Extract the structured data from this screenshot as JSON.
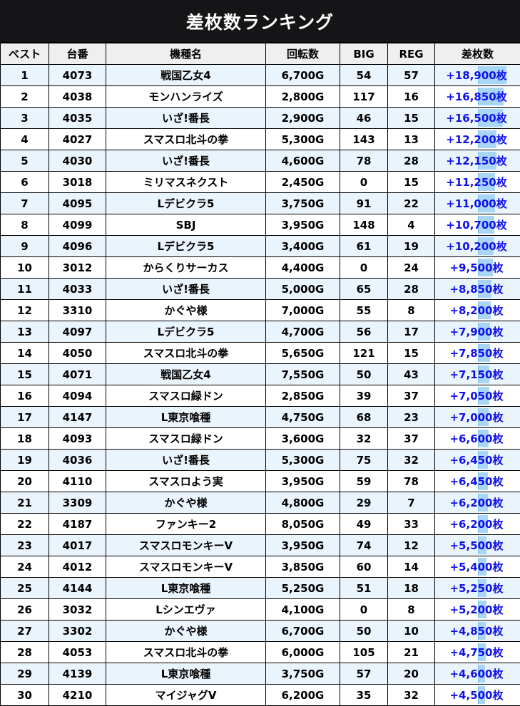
{
  "title": "差枚数ランキング",
  "headers": {
    "rank": "ベスト",
    "machine_no": "台番",
    "model": "機種名",
    "spins": "回転数",
    "big": "BIG",
    "reg": "REG",
    "diff": "差枚数"
  },
  "rows": [
    {
      "rank": "1",
      "no": "4073",
      "model": "戦国乙女4",
      "spins": "6,700G",
      "big": "54",
      "reg": "57",
      "diff": "+18,900枚",
      "diff_value": 18900
    },
    {
      "rank": "2",
      "no": "4038",
      "model": "モンハンライズ",
      "spins": "2,800G",
      "big": "117",
      "reg": "16",
      "diff": "+16,850枚",
      "diff_value": 16850
    },
    {
      "rank": "3",
      "no": "4035",
      "model": "いざ!番長",
      "spins": "2,900G",
      "big": "46",
      "reg": "15",
      "diff": "+16,500枚",
      "diff_value": 16500
    },
    {
      "rank": "4",
      "no": "4027",
      "model": "スマスロ北斗の拳",
      "spins": "5,300G",
      "big": "143",
      "reg": "13",
      "diff": "+12,200枚",
      "diff_value": 12200
    },
    {
      "rank": "5",
      "no": "4030",
      "model": "いざ!番長",
      "spins": "4,600G",
      "big": "78",
      "reg": "28",
      "diff": "+12,150枚",
      "diff_value": 12150
    },
    {
      "rank": "6",
      "no": "3018",
      "model": "ミリマスネクスト",
      "spins": "2,450G",
      "big": "0",
      "reg": "15",
      "diff": "+11,250枚",
      "diff_value": 11250
    },
    {
      "rank": "7",
      "no": "4095",
      "model": "Lデビクラ5",
      "spins": "3,750G",
      "big": "91",
      "reg": "22",
      "diff": "+11,000枚",
      "diff_value": 11000
    },
    {
      "rank": "8",
      "no": "4099",
      "model": "SBJ",
      "spins": "3,950G",
      "big": "148",
      "reg": "4",
      "diff": "+10,700枚",
      "diff_value": 10700
    },
    {
      "rank": "9",
      "no": "4096",
      "model": "Lデビクラ5",
      "spins": "3,400G",
      "big": "61",
      "reg": "19",
      "diff": "+10,200枚",
      "diff_value": 10200
    },
    {
      "rank": "10",
      "no": "3012",
      "model": "からくりサーカス",
      "spins": "4,400G",
      "big": "0",
      "reg": "24",
      "diff": "+9,500枚",
      "diff_value": 9500
    },
    {
      "rank": "11",
      "no": "4033",
      "model": "いざ!番長",
      "spins": "5,000G",
      "big": "65",
      "reg": "28",
      "diff": "+8,850枚",
      "diff_value": 8850
    },
    {
      "rank": "12",
      "no": "3310",
      "model": "かぐや様",
      "spins": "7,000G",
      "big": "55",
      "reg": "8",
      "diff": "+8,200枚",
      "diff_value": 8200
    },
    {
      "rank": "13",
      "no": "4097",
      "model": "Lデビクラ5",
      "spins": "4,700G",
      "big": "56",
      "reg": "17",
      "diff": "+7,900枚",
      "diff_value": 7900
    },
    {
      "rank": "14",
      "no": "4050",
      "model": "スマスロ北斗の拳",
      "spins": "5,650G",
      "big": "121",
      "reg": "15",
      "diff": "+7,850枚",
      "diff_value": 7850
    },
    {
      "rank": "15",
      "no": "4071",
      "model": "戦国乙女4",
      "spins": "7,550G",
      "big": "50",
      "reg": "43",
      "diff": "+7,150枚",
      "diff_value": 7150
    },
    {
      "rank": "16",
      "no": "4094",
      "model": "スマスロ緑ドン",
      "spins": "2,850G",
      "big": "39",
      "reg": "37",
      "diff": "+7,050枚",
      "diff_value": 7050
    },
    {
      "rank": "17",
      "no": "4147",
      "model": "L東京喰種",
      "spins": "4,750G",
      "big": "68",
      "reg": "23",
      "diff": "+7,000枚",
      "diff_value": 7000
    },
    {
      "rank": "18",
      "no": "4093",
      "model": "スマスロ緑ドン",
      "spins": "3,600G",
      "big": "32",
      "reg": "37",
      "diff": "+6,600枚",
      "diff_value": 6600
    },
    {
      "rank": "19",
      "no": "4036",
      "model": "いざ!番長",
      "spins": "5,300G",
      "big": "75",
      "reg": "32",
      "diff": "+6,450枚",
      "diff_value": 6450
    },
    {
      "rank": "20",
      "no": "4110",
      "model": "スマスロよう実",
      "spins": "3,950G",
      "big": "59",
      "reg": "78",
      "diff": "+6,450枚",
      "diff_value": 6450
    },
    {
      "rank": "21",
      "no": "3309",
      "model": "かぐや様",
      "spins": "4,800G",
      "big": "29",
      "reg": "7",
      "diff": "+6,200枚",
      "diff_value": 6200
    },
    {
      "rank": "22",
      "no": "4187",
      "model": "ファンキー2",
      "spins": "8,050G",
      "big": "49",
      "reg": "33",
      "diff": "+6,200枚",
      "diff_value": 6200
    },
    {
      "rank": "23",
      "no": "4017",
      "model": "スマスロモンキーV",
      "spins": "3,950G",
      "big": "74",
      "reg": "12",
      "diff": "+5,500枚",
      "diff_value": 5500
    },
    {
      "rank": "24",
      "no": "4012",
      "model": "スマスロモンキーV",
      "spins": "3,850G",
      "big": "60",
      "reg": "14",
      "diff": "+5,400枚",
      "diff_value": 5400
    },
    {
      "rank": "25",
      "no": "4144",
      "model": "L東京喰種",
      "spins": "5,250G",
      "big": "51",
      "reg": "18",
      "diff": "+5,250枚",
      "diff_value": 5250
    },
    {
      "rank": "26",
      "no": "3032",
      "model": "Lシンエヴァ",
      "spins": "4,100G",
      "big": "0",
      "reg": "8",
      "diff": "+5,200枚",
      "diff_value": 5200
    },
    {
      "rank": "27",
      "no": "3302",
      "model": "かぐや様",
      "spins": "6,700G",
      "big": "50",
      "reg": "10",
      "diff": "+4,850枚",
      "diff_value": 4850
    },
    {
      "rank": "28",
      "no": "4053",
      "model": "スマスロ北斗の拳",
      "spins": "6,000G",
      "big": "105",
      "reg": "21",
      "diff": "+4,750枚",
      "diff_value": 4750
    },
    {
      "rank": "29",
      "no": "4139",
      "model": "L東京喰種",
      "spins": "3,750G",
      "big": "57",
      "reg": "20",
      "diff": "+4,600枚",
      "diff_value": 4600
    },
    {
      "rank": "30",
      "no": "4210",
      "model": "マイジャグV",
      "spins": "6,200G",
      "big": "35",
      "reg": "32",
      "diff": "+4,500枚",
      "diff_value": 4500
    }
  ],
  "colors": {
    "title_bg": "#151518",
    "header_bg": "#efefef",
    "stripe_row": "#eaf4fd",
    "diff_text": "#1010ee",
    "diff_bar": "#a9d6f6"
  }
}
